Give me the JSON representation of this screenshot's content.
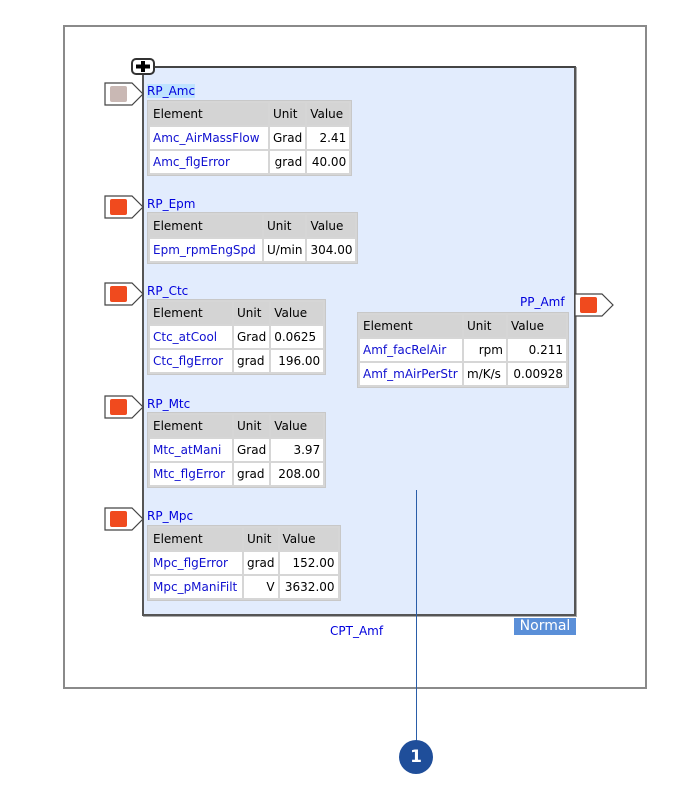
{
  "component": {
    "name": "CPT_Amf",
    "status": "Normal",
    "expand_icon": "plus-icon"
  },
  "receive_ports": [
    {
      "name": "RP_Amc",
      "state_color": "#c9b8b4",
      "headers": [
        "Element",
        "Unit",
        "Value"
      ],
      "rows": [
        {
          "element": "Amc_AirMassFlow",
          "unit": "Grad",
          "value": "2.41"
        },
        {
          "element": "Amc_flgError",
          "unit": "grad",
          "value": "40.00"
        }
      ]
    },
    {
      "name": "RP_Epm",
      "state_color": "#f04a1e",
      "headers": [
        "Element",
        "Unit",
        "Value"
      ],
      "rows": [
        {
          "element": "Epm_rpmEngSpd",
          "unit": "U/min",
          "value": "304.00"
        }
      ]
    },
    {
      "name": "RP_Ctc",
      "state_color": "#f04a1e",
      "headers": [
        "Element",
        "Unit",
        "Value"
      ],
      "rows": [
        {
          "element": "Ctc_atCool",
          "unit": "Grad",
          "value": "0.0625"
        },
        {
          "element": "Ctc_flgError",
          "unit": "grad",
          "value": "196.00"
        }
      ]
    },
    {
      "name": "RP_Mtc",
      "state_color": "#f04a1e",
      "headers": [
        "Element",
        "Unit",
        "Value"
      ],
      "rows": [
        {
          "element": "Mtc_atMani",
          "unit": "Grad",
          "value": "3.97"
        },
        {
          "element": "Mtc_flgError",
          "unit": "grad",
          "value": "208.00"
        }
      ]
    },
    {
      "name": "RP_Mpc",
      "state_color": "#f04a1e",
      "headers": [
        "Element",
        "Unit",
        "Value"
      ],
      "rows": [
        {
          "element": "Mpc_flgError",
          "unit": "grad",
          "value": "152.00"
        },
        {
          "element": "Mpc_pManiFilt",
          "unit": "V",
          "value": "3632.00"
        }
      ]
    }
  ],
  "provide_ports": [
    {
      "name": "PP_Amf",
      "state_color": "#f04a1e",
      "headers": [
        "Element",
        "Unit",
        "Value"
      ],
      "rows": [
        {
          "element": "Amf_facRelAir",
          "unit": "rpm",
          "value": "0.211"
        },
        {
          "element": "Amf_mAirPerStr",
          "unit": "m/K/s",
          "value": "0.00928"
        }
      ]
    }
  ],
  "callouts": [
    {
      "number": "1"
    }
  ]
}
